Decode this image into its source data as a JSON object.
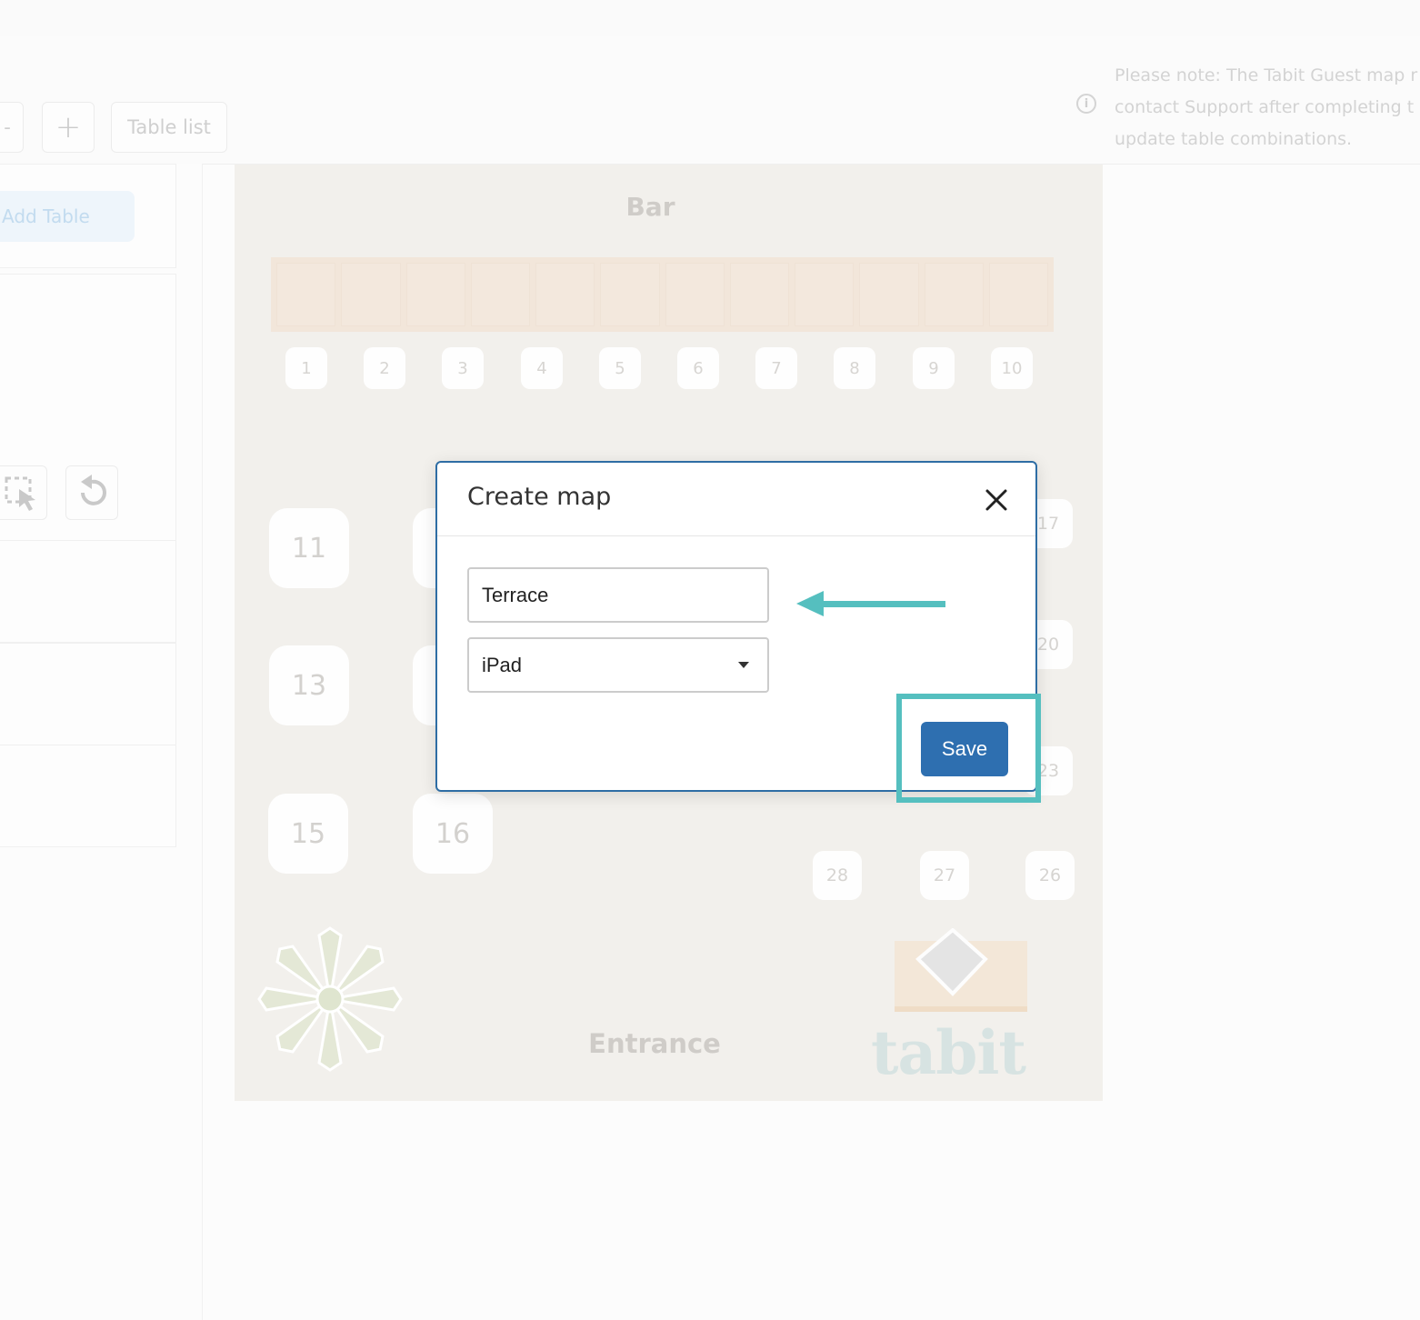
{
  "toolbar": {
    "partial_button_label": "-",
    "add_button_label": "+",
    "table_list_label": "Table list",
    "note_text": "Please note: The Tabit Guest map r\ncontact Support after completing t\nupdate table combinations."
  },
  "left_panel": {
    "add_table_label": "Add Table"
  },
  "floor_map": {
    "bar_label": "Bar",
    "entrance_label": "Entrance",
    "bar_stools": [
      "1",
      "2",
      "3",
      "4",
      "5",
      "6",
      "7",
      "8",
      "9",
      "10"
    ],
    "large_tables": [
      "11",
      "13",
      "15",
      "16"
    ],
    "small_tables": [
      "17",
      "20",
      "23",
      "28",
      "27",
      "26"
    ],
    "logo_text": "tabit"
  },
  "dialog": {
    "title": "Create map",
    "name_value": "Terrace",
    "device_selected": "iPad",
    "save_label": "Save"
  },
  "colors": {
    "primary": "#2e6fb0",
    "dialog_border": "#2e6da4",
    "annotation": "#55bfbf"
  }
}
